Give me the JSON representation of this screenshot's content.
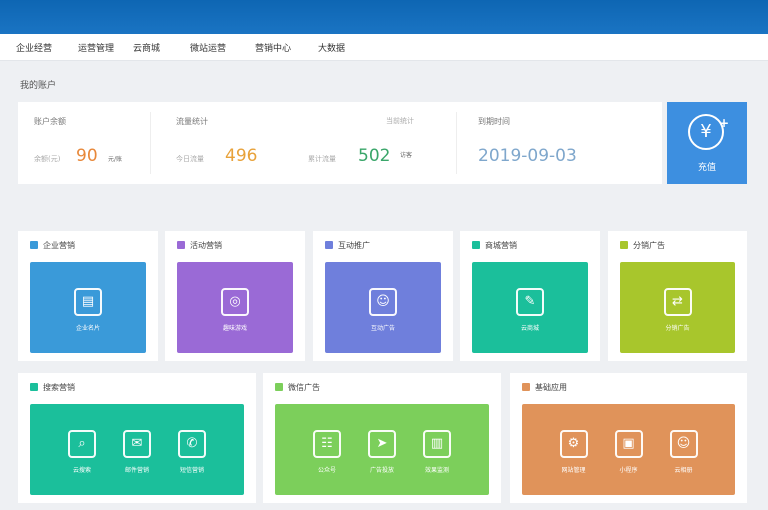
{
  "nav": [
    "企业经营",
    "运营管理",
    "云商城",
    "微站运营",
    "营销中心",
    "大数据"
  ],
  "account": {
    "section_title": "我的账户",
    "balance": {
      "label": "账户余额",
      "sub": "余额(元)",
      "value": "90",
      "unit": "元/账"
    },
    "traffic": {
      "label": "流量统计",
      "note": "当前统计",
      "sub1": "今日流量",
      "value1": "496",
      "sub2": "累计流量",
      "value2": "502",
      "unit2": "访客"
    },
    "expiry": {
      "label": "到期时间",
      "value": "2019-09-03"
    },
    "recharge": {
      "label": "充值",
      "icon": "yen-icon"
    }
  },
  "cards": [
    {
      "title": "企业营销",
      "color": "#3a9ad9",
      "buttons": [
        {
          "label": "企业名片",
          "icon": "card-icon"
        }
      ]
    },
    {
      "title": "活动营销",
      "color": "#9a6ad6",
      "buttons": [
        {
          "label": "趣味游戏",
          "icon": "compass-icon"
        }
      ]
    },
    {
      "title": "互动推广",
      "color": "#6f7fdc",
      "buttons": [
        {
          "label": "互动广告",
          "icon": "chat-icon"
        }
      ]
    },
    {
      "title": "商城营销",
      "color": "#1bbf9b",
      "buttons": [
        {
          "label": "云商城",
          "icon": "edit-icon"
        }
      ]
    },
    {
      "title": "分销广告",
      "color": "#a8c62c",
      "buttons": [
        {
          "label": "分销广告",
          "icon": "share-icon"
        }
      ]
    },
    {
      "title": "搜索营销",
      "color": "#1bbf9b",
      "buttons": [
        {
          "label": "云搜索",
          "icon": "search-icon"
        },
        {
          "label": "邮件营销",
          "icon": "mail-icon"
        },
        {
          "label": "短信营销",
          "icon": "message-icon"
        }
      ]
    },
    {
      "title": "微信广告",
      "color": "#7ccf5b",
      "buttons": [
        {
          "label": "公众号",
          "icon": "wechat-icon"
        },
        {
          "label": "广告投放",
          "icon": "send-icon"
        },
        {
          "label": "效果监测",
          "icon": "chart-icon"
        }
      ]
    },
    {
      "title": "基础应用",
      "color": "#e0935a",
      "buttons": [
        {
          "label": "网站管理",
          "icon": "gear-icon"
        },
        {
          "label": "小程序",
          "icon": "app-icon"
        },
        {
          "label": "云相册",
          "icon": "smile-icon"
        }
      ]
    }
  ]
}
